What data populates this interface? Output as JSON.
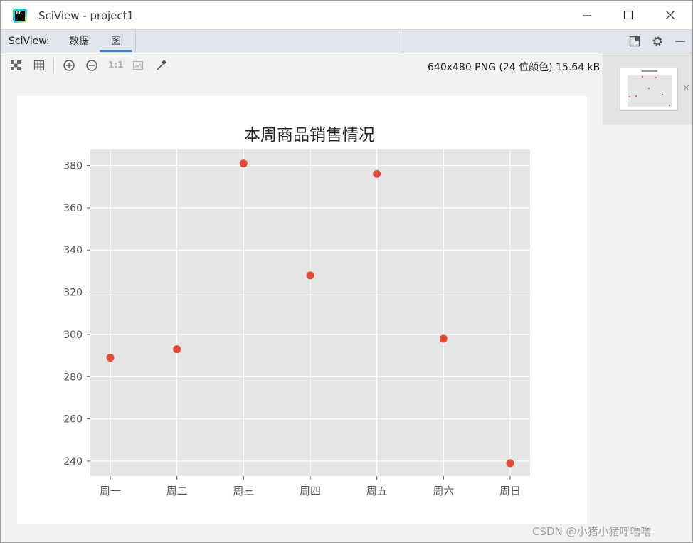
{
  "window": {
    "title": "SciView - project1"
  },
  "tabbar": {
    "label": "SciView:",
    "tabs": [
      {
        "label": "数据",
        "active": false
      },
      {
        "label": "图",
        "active": true
      }
    ]
  },
  "toolbar": {
    "actual_size_label": "1:1",
    "image_info": "640x480 PNG (24 位颜色) 15.64 kB"
  },
  "watermark": "CSDN @小猪小猪呼噜噜",
  "colors": {
    "accent": "#3b82d6",
    "point": "#e24a33",
    "plot_bg": "#e5e5e5"
  },
  "chart_data": {
    "type": "scatter",
    "title": "本周商品销售情况",
    "xlabel": "",
    "ylabel": "",
    "categories": [
      "周一",
      "周二",
      "周三",
      "周四",
      "周五",
      "周六",
      "周日"
    ],
    "values": [
      289,
      293,
      381,
      328,
      376,
      298,
      239
    ],
    "yticks": [
      240,
      260,
      280,
      300,
      320,
      340,
      360,
      380
    ],
    "ylim": [
      232.9,
      387.6
    ],
    "grid": true,
    "legend": "none"
  }
}
